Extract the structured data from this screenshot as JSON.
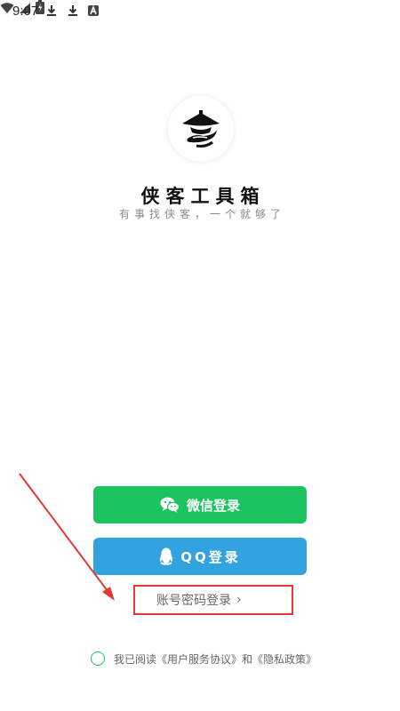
{
  "status_bar": {
    "time": "9:07",
    "icons": [
      "download-icon",
      "download-icon",
      "a-app-icon",
      "wifi-icon",
      "signal-icon",
      "battery-icon"
    ]
  },
  "app": {
    "title": "侠客工具箱",
    "slogan": "有事找侠客，一个就够了",
    "logo": "hat-masked-swordsman-logo"
  },
  "buttons": {
    "wechat_label": "微信登录",
    "qq_label": "QQ登录",
    "account_label": "账号密码登录"
  },
  "agreement": {
    "text": "我已阅读《用户服务协议》和《隐私政策》",
    "checked": false
  },
  "colors": {
    "wechat_green": "#1bc45e",
    "qq_blue": "#33a3e0",
    "annotation_red": "#e53935"
  }
}
